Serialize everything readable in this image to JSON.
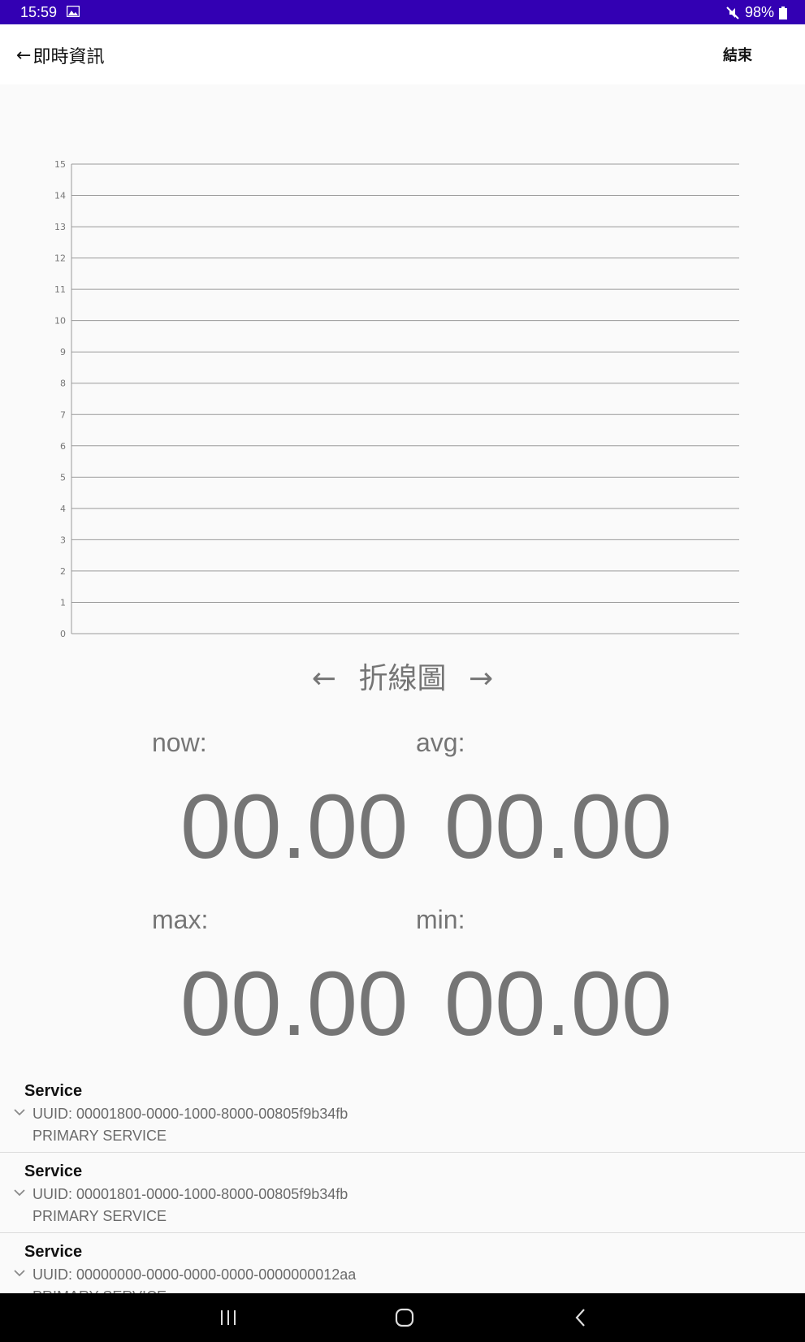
{
  "status_bar": {
    "time": "15:59",
    "battery": "98%",
    "icons": [
      "image-icon",
      "mute-icon",
      "battery-icon"
    ]
  },
  "app_bar": {
    "back_arrow": "←",
    "title": "即時資訊",
    "end_label": "結束"
  },
  "chart_data": {
    "type": "line",
    "title": "",
    "xlabel": "",
    "ylabel": "",
    "x": [],
    "series": [],
    "ylim": [
      0,
      15
    ],
    "y_ticks": [
      "15",
      "14",
      "13",
      "12",
      "11",
      "10",
      "9",
      "8",
      "7",
      "6",
      "5",
      "4",
      "3",
      "2",
      "1",
      "0"
    ],
    "grid": true,
    "grid_color": "#999999"
  },
  "chart_nav": {
    "prev_arrow": "←",
    "title": "折線圖",
    "next_arrow": "→"
  },
  "stats": {
    "now_label": "now:",
    "now_value": "00.00",
    "avg_label": "avg:",
    "avg_value": "00.00",
    "max_label": "max:",
    "max_value": "00.00",
    "min_label": "min:",
    "min_value": "00.00"
  },
  "services": [
    {
      "title": "Service",
      "uuid": "UUID: 00001800-0000-1000-8000-00805f9b34fb",
      "type": "PRIMARY SERVICE"
    },
    {
      "title": "Service",
      "uuid": "UUID: 00001801-0000-1000-8000-00805f9b34fb",
      "type": "PRIMARY SERVICE"
    },
    {
      "title": "Service",
      "uuid": "UUID: 00000000-0000-0000-0000-0000000012aa",
      "type": "PRIMARY SERVICE"
    }
  ],
  "colors": {
    "status_bar": "#3300b3",
    "app_bar": "#ffffff",
    "background": "#fafafa",
    "stat_text": "#757575",
    "nav_bar": "#000000"
  },
  "nav_bar_icons": [
    "recent-apps-icon",
    "home-icon",
    "back-icon"
  ]
}
